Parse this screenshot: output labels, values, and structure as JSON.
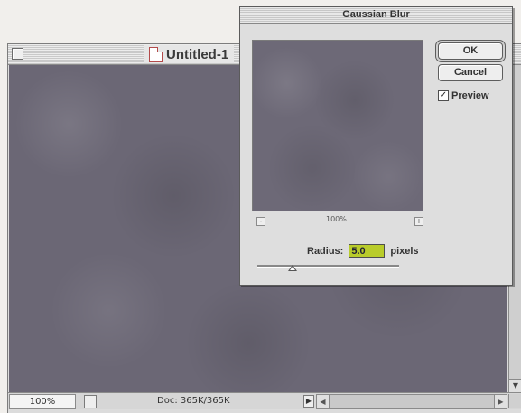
{
  "document_window": {
    "title": "Untitled-1",
    "status": {
      "zoom": "100%",
      "doc_size": "Doc: 365K/365K"
    }
  },
  "gaussian_blur_dialog": {
    "title": "Gaussian Blur",
    "ok_label": "OK",
    "cancel_label": "Cancel",
    "preview": {
      "checked": true,
      "label": "Preview",
      "zoom": "100%"
    },
    "radius": {
      "label": "Radius:",
      "value": "5.0",
      "unit": "pixels",
      "slider_fraction": 0.25
    }
  },
  "icons": [
    "close-box-icon",
    "document-icon",
    "info-icon",
    "menu-arrow-icon",
    "scroll-left-icon",
    "scroll-right-icon",
    "scroll-down-icon",
    "zoom-out-icon",
    "zoom-in-icon",
    "checkmark-icon",
    "slider-thumb-icon"
  ],
  "colors": {
    "radius_field": "#b9cc2a",
    "canvas": "#6b6775"
  }
}
